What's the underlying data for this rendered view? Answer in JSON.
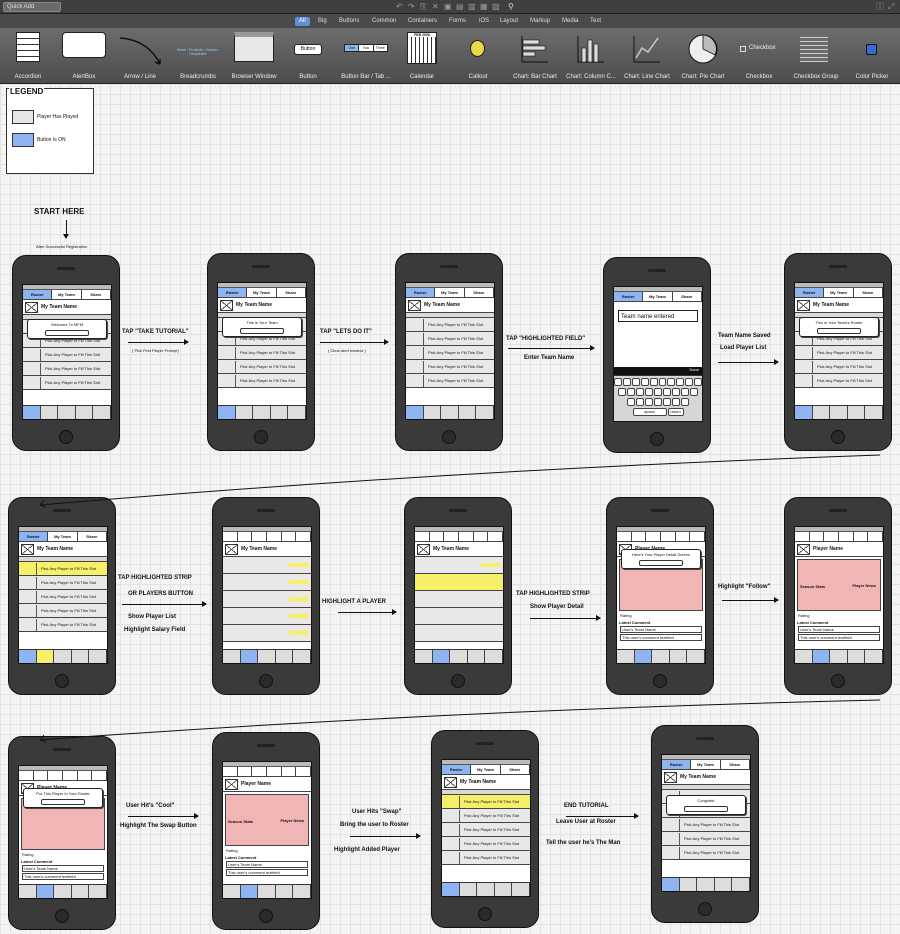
{
  "toolbar": {
    "quick_add_placeholder": "Quick Add",
    "categories": [
      "All",
      "Big",
      "Buttons",
      "Common",
      "Containers",
      "Forms",
      "iOS",
      "Layout",
      "Markup",
      "Media",
      "Text"
    ],
    "active_category": "All"
  },
  "components": [
    "Accordion",
    "AlertBox",
    "Arrow / Line",
    "Breadcrumbs",
    "Browser Window",
    "Button",
    "Button Bar / Tab ...",
    "Calendar",
    "Callout",
    "Chart: Bar Chart",
    "Chart: Column C...",
    "Chart: Line Chart",
    "Chart: Pie Chart",
    "Checkbox",
    "Checkbox Group",
    "Color Picker"
  ],
  "component_inner": {
    "button": "Button",
    "checkbox": "Checkbox",
    "calendar": "FEB 2008",
    "tabs": [
      "One",
      "Two",
      "Three"
    ],
    "breadcrumbs": "Home › Products › Xtreme › Dehydrator"
  },
  "legend": {
    "title": "LEGEND",
    "items": [
      {
        "label": "Player Has Played",
        "color": "#e6e6e6"
      },
      {
        "label": "Button Is ON",
        "color": "#8fb4f2"
      }
    ]
  },
  "flow": {
    "start": "START HERE",
    "start_sub": "After Successful Registration",
    "steps": [
      {
        "line1": "TAP \"TAKE TUTORIAL\"",
        "line2": "( Pick First Player Prompt)"
      },
      {
        "line1": "TAP \"LETS DO IT\"",
        "line2": "( Clear alert window )"
      },
      {
        "line1": "TAP \"HIGHLIGHTED FIELD\"",
        "line2": "Enter Team Name"
      },
      {
        "line1": "Team Name Saved",
        "line2": "Load Player List"
      },
      {
        "line1": "TAP HIGHLIGHTED STRIP",
        "line2": "OR PLAYERS BUTTON",
        "line3": "Show Player List",
        "line4": "Highlight Salary Field"
      },
      {
        "line1": "HIGHLIGHT A PLAYER"
      },
      {
        "line1": "TAP HIGHLIGHTED STRIP",
        "line2": "Show Player Detail"
      },
      {
        "line1": "Highlight \"Follow\""
      },
      {
        "line1": "User Hit's \"Cool\"",
        "line2": "Highlight The Swap Button"
      },
      {
        "line1": "User Hits \"Swap\"",
        "line2": "Bring the user to Roster",
        "line3": "Highlight Added Player"
      },
      {
        "line1": "END TUTORIAL",
        "line2": "Leave User at Roster",
        "line3": "Tell the user he's The Man"
      }
    ]
  },
  "screen_text": {
    "tabs": [
      "Roster",
      "My Team",
      "Share"
    ],
    "team_name": "My Team Name",
    "pick_slot": "Pick Any Player to Fill This Slot",
    "team_name_entered": "Team name entered",
    "welcome": "Welcome To MFM",
    "this_is_your_team": "This is Your Team",
    "this_is_your_roster": "This is Your Team's Roster",
    "player_name": "Player Name",
    "user_team_name": "User's Team Name",
    "latest_comment": "Latest Comment",
    "comment": "This user's comment textfield",
    "congrats": "Congrats!",
    "detail_screen": "Here's Your Player Detail Screen",
    "put_player": "Put This Player In Your Roster",
    "season_stats": "Season Stats",
    "player_news": "Player News",
    "rating": "Rating",
    "keyboard_space": "space",
    "keyboard_return": "return",
    "done": "Done"
  }
}
